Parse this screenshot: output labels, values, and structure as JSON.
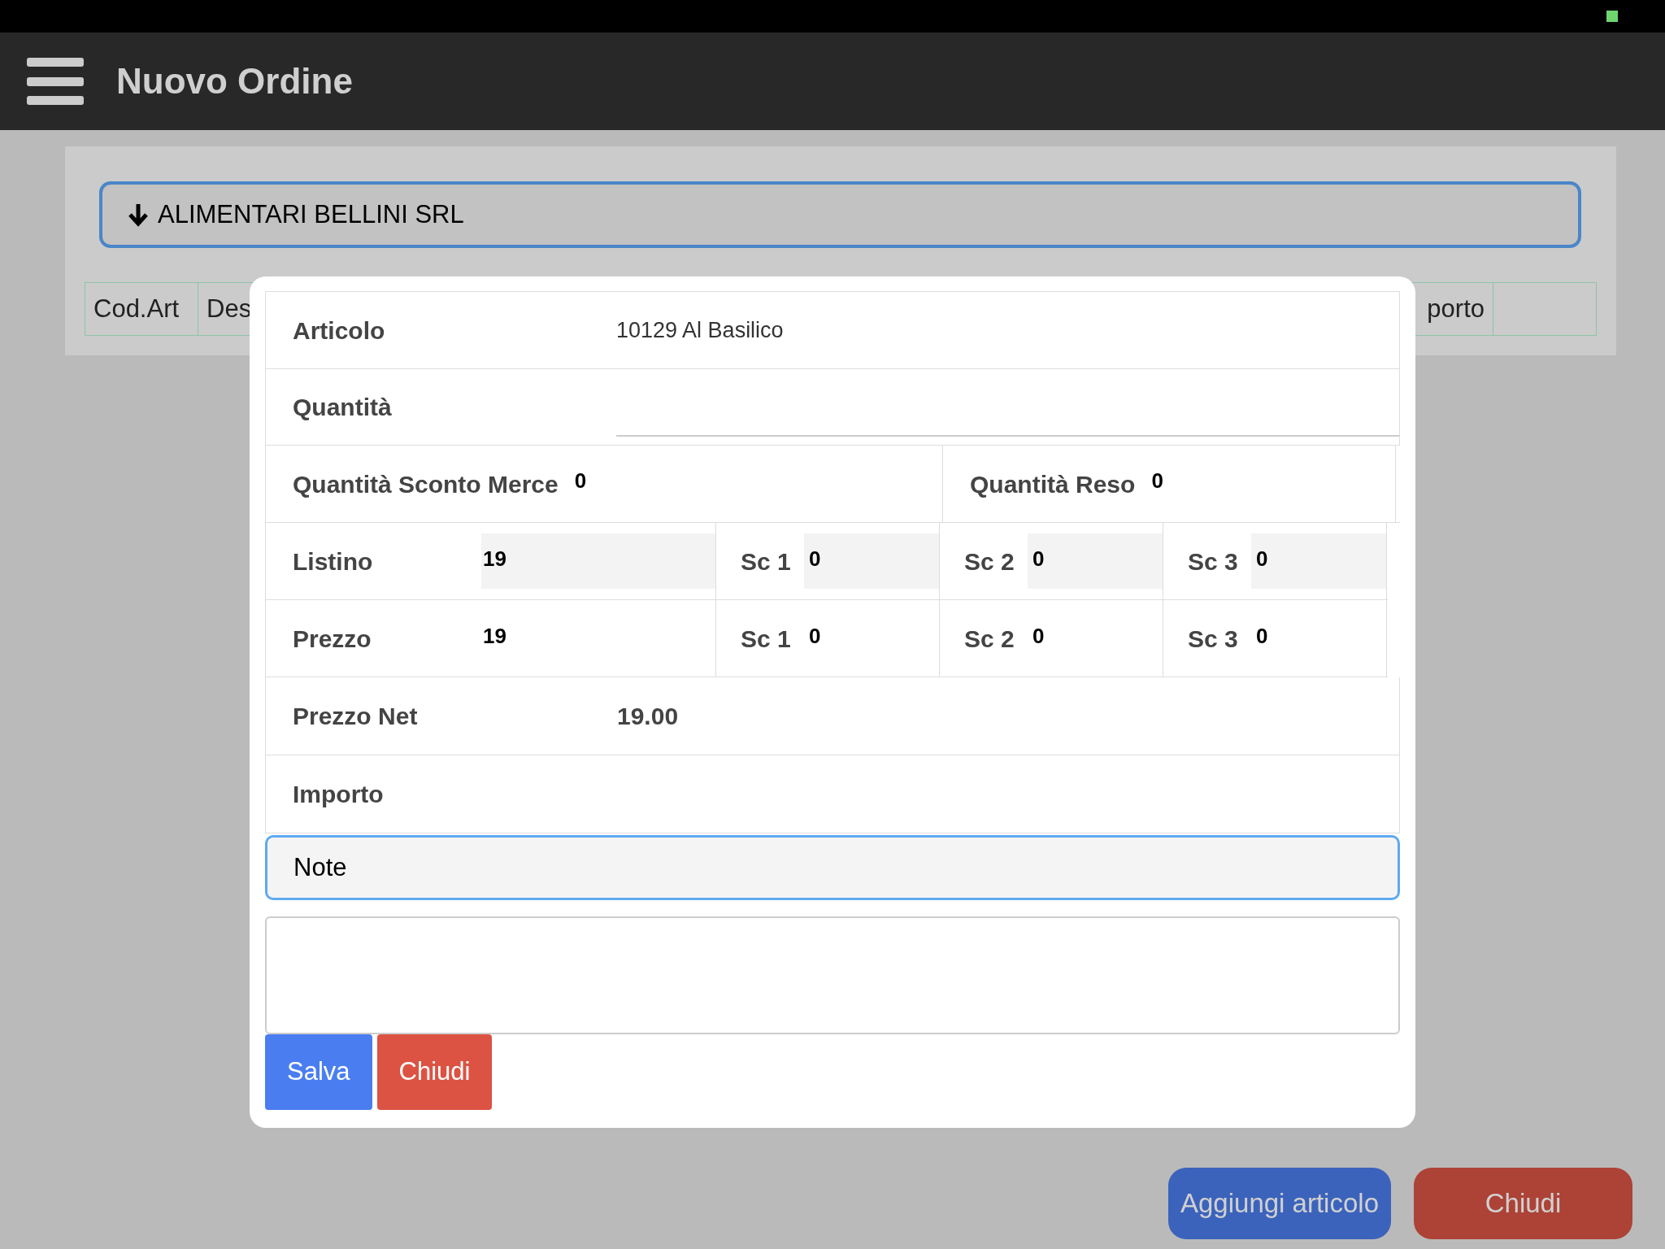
{
  "header": {
    "title": "Nuovo Ordine"
  },
  "customer": {
    "name": "ALIMENTARI BELLINI SRL"
  },
  "table": {
    "columns": [
      "Cod.Art",
      "Des",
      "porto"
    ]
  },
  "dialog": {
    "article": {
      "label": "Articolo",
      "value": "10129 Al Basilico"
    },
    "quantity": {
      "label": "Quantità"
    },
    "quantity_row": [
      {
        "label": "Quantità Sconto Merce",
        "value": "0"
      },
      {
        "label": "Quantità Reso",
        "value": "0"
      }
    ],
    "price_rows": [
      {
        "label": "Listino",
        "kind": "readonly",
        "value": "19",
        "discounts": [
          {
            "label": "Sc 1",
            "value": "0"
          },
          {
            "label": "Sc 2",
            "value": "0"
          },
          {
            "label": "Sc 3",
            "value": "0"
          }
        ]
      },
      {
        "label": "Prezzo",
        "kind": "editable",
        "value": "19",
        "discounts": [
          {
            "label": "Sc 1",
            "value": "0"
          },
          {
            "label": "Sc 2",
            "value": "0"
          },
          {
            "label": "Sc 3",
            "value": "0"
          }
        ]
      }
    ],
    "net_price": {
      "label": "Prezzo Net",
      "value": "19.00"
    },
    "amount": {
      "label": "Importo"
    },
    "note": {
      "label": "Note"
    },
    "buttons": [
      {
        "label": "Salva",
        "kind": "primary"
      },
      {
        "label": "Chiudi",
        "kind": "danger"
      }
    ]
  },
  "footer_buttons": [
    {
      "label": "Aggiungi articolo",
      "kind": "primary"
    },
    {
      "label": "Chiudi",
      "kind": "danger"
    }
  ]
}
